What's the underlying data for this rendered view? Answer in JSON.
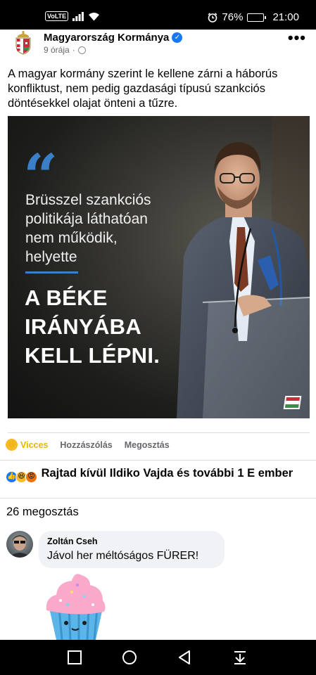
{
  "status_bar": {
    "network": "VoLTE",
    "battery_percent": "76%",
    "battery_level": 0.76,
    "time": "21:00"
  },
  "post": {
    "page_name": "Magyarország Kormánya",
    "time_ago": "9 órája",
    "dot": "·",
    "text": "A magyar kormány szerint le kellene zárni a háborús konfliktust, nem pedig gazdasági típusú szankciós döntésekkel olajat önteni a tűzre.",
    "image": {
      "quote_mark": "“",
      "quote_text": "Brüsszel szankciós politikája láthatóan nem működik, helyette",
      "quote_bold": "A BÉKE IRÁNYÁBA KELL LÉPNI."
    }
  },
  "actions": {
    "reaction_label": "Vicces",
    "comment_label": "Hozzászólás",
    "share_label": "Megosztás"
  },
  "reactions_summary": "Rajtad kívül Ildiko Vajda és további 1 E ember",
  "shares_count": "26 megosztás",
  "comment": {
    "author": "Zoltán Cseh",
    "text": "Jávol her méltóságos FÜRER!"
  },
  "icons": {
    "more": "more-options-icon",
    "verified": "verified-badge-icon",
    "globe": "public-globe-icon",
    "haha": "haha-reaction-icon",
    "like": "like-reaction-icon",
    "angry": "angry-reaction-icon"
  },
  "colors": {
    "facebook_blue": "#1877f2",
    "quote_blue": "#3a80c8",
    "vicces_yellow": "#e8b400",
    "secondary_text": "#65676b",
    "comment_bg": "#f0f2f5"
  }
}
